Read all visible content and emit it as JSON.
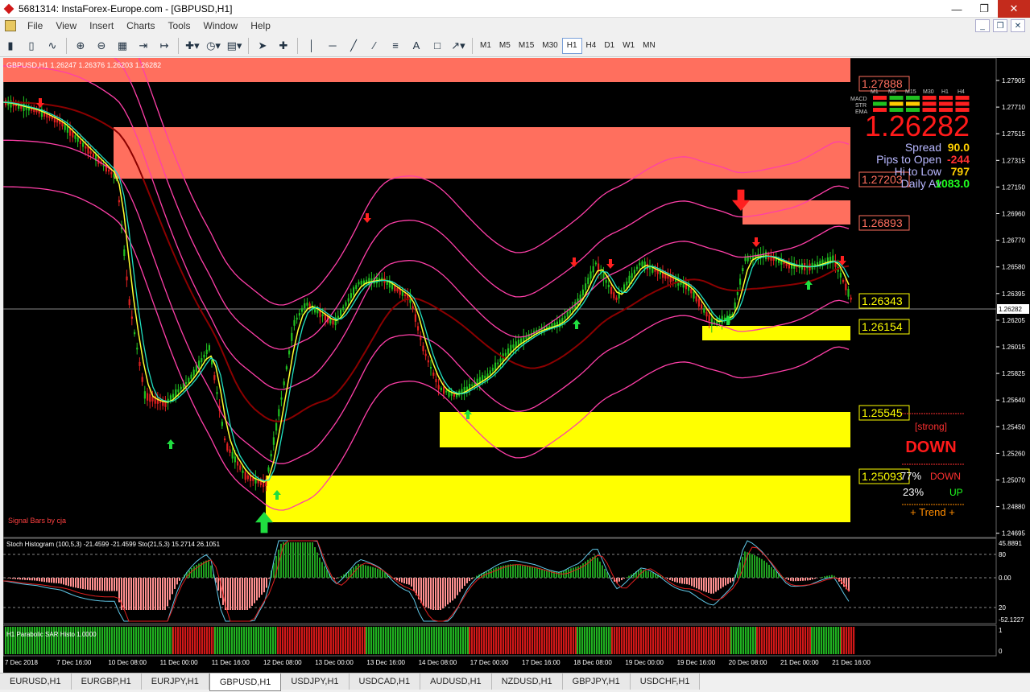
{
  "window": {
    "title": "5681314: InstaForex-Europe.com - [GBPUSD,H1]"
  },
  "menu": [
    "File",
    "View",
    "Insert",
    "Charts",
    "Tools",
    "Window",
    "Help"
  ],
  "toolbar": {
    "timeframes": [
      "M1",
      "M5",
      "M15",
      "M30",
      "H1",
      "H4",
      "D1",
      "W1",
      "MN"
    ],
    "active_timeframe": "H1"
  },
  "chart": {
    "header": "GBPUSD,H1  1.26247 1.26376 1.26203 1.26282",
    "signal_label": "Signal Bars by cja",
    "price_axis": [
      "1.27905",
      "1.27710",
      "1.27515",
      "1.27315",
      "1.27150",
      "1.26960",
      "1.26770",
      "1.26580",
      "1.26395",
      "1.26205",
      "1.26015",
      "1.25825",
      "1.25640",
      "1.25450",
      "1.25260",
      "1.25070",
      "1.24880",
      "1.24695"
    ],
    "current_price_tag": "1.26282",
    "level_labels": [
      "1.27888",
      "1.27203",
      "1.26893",
      "1.26343",
      "1.26154",
      "1.25545",
      "1.25093"
    ],
    "time_axis": [
      "7 Dec 2018",
      "7 Dec 16:00",
      "10 Dec 08:00",
      "11 Dec 00:00",
      "11 Dec 16:00",
      "12 Dec 08:00",
      "13 Dec 00:00",
      "13 Dec 16:00",
      "14 Dec 08:00",
      "17 Dec 00:00",
      "17 Dec 16:00",
      "18 Dec 08:00",
      "19 Dec 00:00",
      "19 Dec 16:00",
      "20 Dec 08:00",
      "21 Dec 00:00",
      "21 Dec 16:00"
    ]
  },
  "dashboard": {
    "tf_headers": [
      "M1",
      "M5",
      "M15",
      "M30",
      "H1",
      "H4"
    ],
    "rows": [
      "MACD",
      "STR",
      "EMA"
    ],
    "price": "1.26282",
    "spread_label": "Spread",
    "spread_value": "90.0",
    "pips_label": "Pips to Open",
    "pips_value": "-244",
    "hilo_label": "Hi to Low",
    "hilo_value": "797",
    "daily_label": "Daily Av",
    "daily_value": "1083.0",
    "strength_label": "[strong]",
    "direction": "DOWN",
    "down_pct": "77%",
    "down_label": "DOWN",
    "up_pct": "23%",
    "up_label": "UP",
    "trend_label": "+ Trend +"
  },
  "stoch_panel": {
    "header": "Stoch Histogram (100,5,3) -21.4599 -21.4599  Sto(21,5,3) 15.2714 26.1051",
    "axis": [
      "45.8891",
      "80",
      "0.00",
      "20",
      "-52.1227"
    ]
  },
  "sar_panel": {
    "header": "H1 Parabolic SAR Histo 1.0000",
    "axis": [
      "1",
      "0"
    ]
  },
  "tabs": [
    "EURUSD,H1",
    "EURGBP,H1",
    "EURJPY,H1",
    "GBPUSD,H1",
    "USDJPY,H1",
    "USDCAD,H1",
    "AUDUSD,H1",
    "NZDUSD,H1",
    "GBPJPY,H1",
    "USDCHF,H1"
  ],
  "active_tab": "GBPUSD,H1",
  "colors": {
    "zone_red": "#ff6f5e",
    "zone_yellow": "#ffff00",
    "bull": "#20c020",
    "bear": "#e02020",
    "band": "#ff3fa8",
    "fast": "#ffff30",
    "slow": "#20e0c0"
  }
}
